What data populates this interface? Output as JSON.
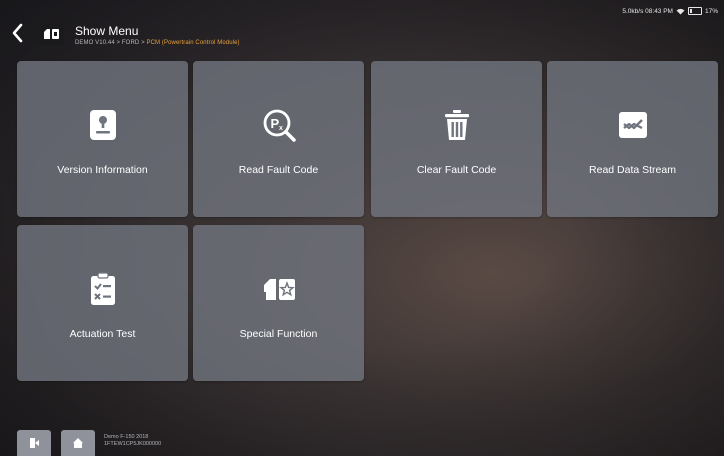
{
  "header": {
    "title": "Show Menu",
    "crumb_prefix": "DEMO V10.44 > FORD > ",
    "crumb_highlight": "PCM (Powertrain Control Module)",
    "status": "5.0kb/s 08:43 PM",
    "battery": "17%"
  },
  "tiles": [
    {
      "label": "Version Information",
      "icon": "version-info-icon"
    },
    {
      "label": "Read Fault Code",
      "icon": "read-fault-code-icon"
    },
    {
      "label": "Clear Fault Code",
      "icon": "trash-icon"
    },
    {
      "label": "Read Data Stream",
      "icon": "data-stream-icon"
    },
    {
      "label": "Actuation Test",
      "icon": "checklist-icon"
    },
    {
      "label": "Special Function",
      "icon": "special-function-icon"
    }
  ],
  "footer": {
    "vehicle_line1": "Demo F-150 2018",
    "vehicle_line2": "1FTEW1CP5JK000000"
  },
  "colors": {
    "tile_bg": "#70747e",
    "accent": "#e8a13a"
  }
}
